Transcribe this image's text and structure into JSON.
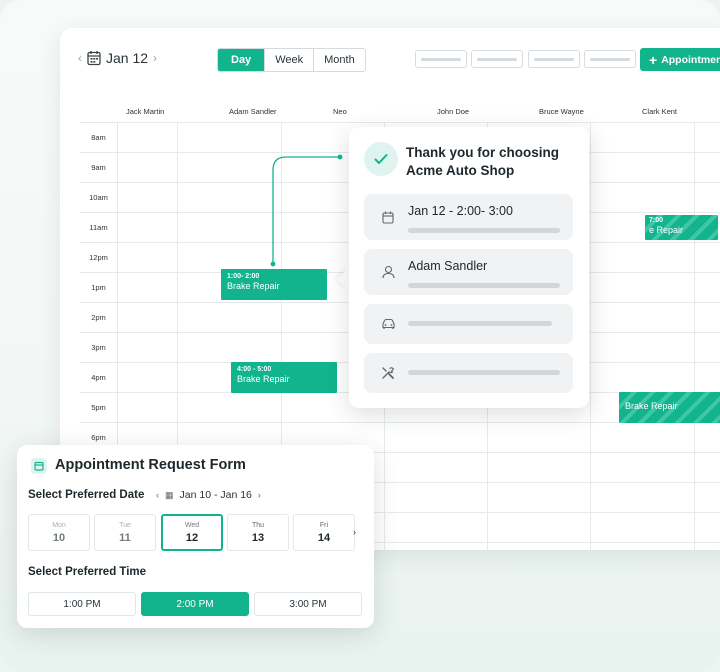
{
  "toolbar": {
    "date": "Jan 12",
    "views": [
      "Day",
      "Week",
      "Month"
    ],
    "active_view": "Day",
    "appointment_button": "Appointment"
  },
  "calendar": {
    "staff": [
      "Jack Martin",
      "Adam Sandler",
      "Neo",
      "John Doe",
      "Bruce Wayne",
      "Clark Kent"
    ],
    "times": [
      "8am",
      "9am",
      "10am",
      "11am",
      "12pm",
      "1pm",
      "2pm",
      "3pm",
      "4pm",
      "5pm",
      "6pm"
    ],
    "events": [
      {
        "time": "1:00- 2:00",
        "title": "Brake Repair"
      },
      {
        "time": "4:00 - 5:00",
        "title": "Brake Repair"
      },
      {
        "time": "7:00",
        "title": "e Repair"
      },
      {
        "time": "",
        "title": "Brake Repair"
      }
    ]
  },
  "popup": {
    "title": "Thank you for choosing Acme Auto Shop",
    "datetime": "Jan 12 - 2:00- 3:00",
    "customer": "Adam Sandler"
  },
  "form": {
    "title": "Appointment Request Form",
    "date_label": "Select Preferred Date",
    "date_range": "Jan 10 - Jan 16",
    "days": [
      {
        "name": "Mon",
        "date": "10"
      },
      {
        "name": "Tue",
        "date": "11"
      },
      {
        "name": "Wed",
        "date": "12"
      },
      {
        "name": "Thu",
        "date": "13"
      },
      {
        "name": "Fri",
        "date": "14"
      }
    ],
    "selected_day": "12",
    "time_label": "Select Preferred Time",
    "times": [
      "1:00 PM",
      "2:00 PM",
      "3:00 PM"
    ],
    "selected_time": "2:00 PM"
  },
  "colors": {
    "accent": "#12b48e",
    "accent_light": "#dff4ee"
  }
}
